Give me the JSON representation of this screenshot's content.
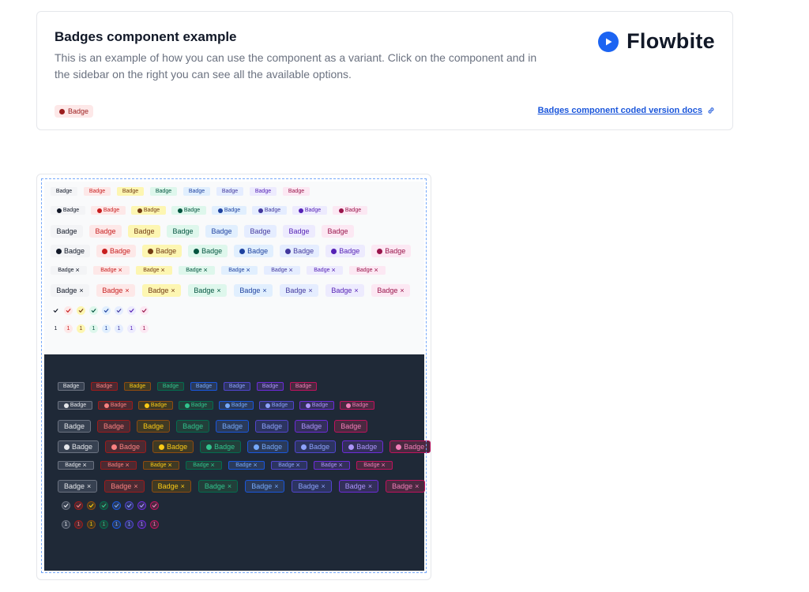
{
  "header": {
    "title": "Badges component example",
    "description": "This is an example of how you can use the component as a variant. Click on the component and in the sidebar on the right you can see all the available options.",
    "brand_name": "Flowbite",
    "sample_badge_label": "Badge",
    "docs_link_label": "Badges component coded version docs"
  },
  "badge_label": "Badge",
  "circle_number": "1",
  "icons": {
    "brand": "play-circle-icon",
    "clock": "clock-icon",
    "close": "close-x-icon",
    "check": "check-icon",
    "link": "link-icon"
  },
  "light_palette": [
    {
      "name": "dark",
      "bg": "#f3f4f6",
      "fg": "#111827"
    },
    {
      "name": "red",
      "bg": "#fde8e8",
      "fg": "#c81e1e"
    },
    {
      "name": "yellow",
      "bg": "#fdf6b2",
      "fg": "#723b13"
    },
    {
      "name": "green",
      "bg": "#def7ec",
      "fg": "#03543f"
    },
    {
      "name": "blue",
      "bg": "#e1effe",
      "fg": "#1e429f"
    },
    {
      "name": "indigo",
      "bg": "#e5edff",
      "fg": "#42389d"
    },
    {
      "name": "purple",
      "bg": "#edebfe",
      "fg": "#5521b5"
    },
    {
      "name": "pink",
      "bg": "#fce8f3",
      "fg": "#99154b"
    }
  ],
  "dark_palette": [
    {
      "name": "dark",
      "bg": "#374151",
      "fg": "#e5e7eb",
      "bd": "#6b7280"
    },
    {
      "name": "red",
      "bg": "#4b2a32",
      "fg": "#f98080",
      "bd": "#9b1c1c"
    },
    {
      "name": "yellow",
      "bg": "#3f3a24",
      "fg": "#faca15",
      "bd": "#8e4b10"
    },
    {
      "name": "green",
      "bg": "#223f3a",
      "fg": "#31c48d",
      "bd": "#046c4e"
    },
    {
      "name": "blue",
      "bg": "#2a3a5a",
      "fg": "#76a9fa",
      "bd": "#1a56db"
    },
    {
      "name": "indigo",
      "bg": "#2c3460",
      "fg": "#8da2fb",
      "bd": "#5145cd"
    },
    {
      "name": "purple",
      "bg": "#332f5a",
      "fg": "#ac94fa",
      "bd": "#6c2bd9"
    },
    {
      "name": "pink",
      "bg": "#4a2940",
      "fg": "#f17eb8",
      "bd": "#bf125d"
    }
  ]
}
